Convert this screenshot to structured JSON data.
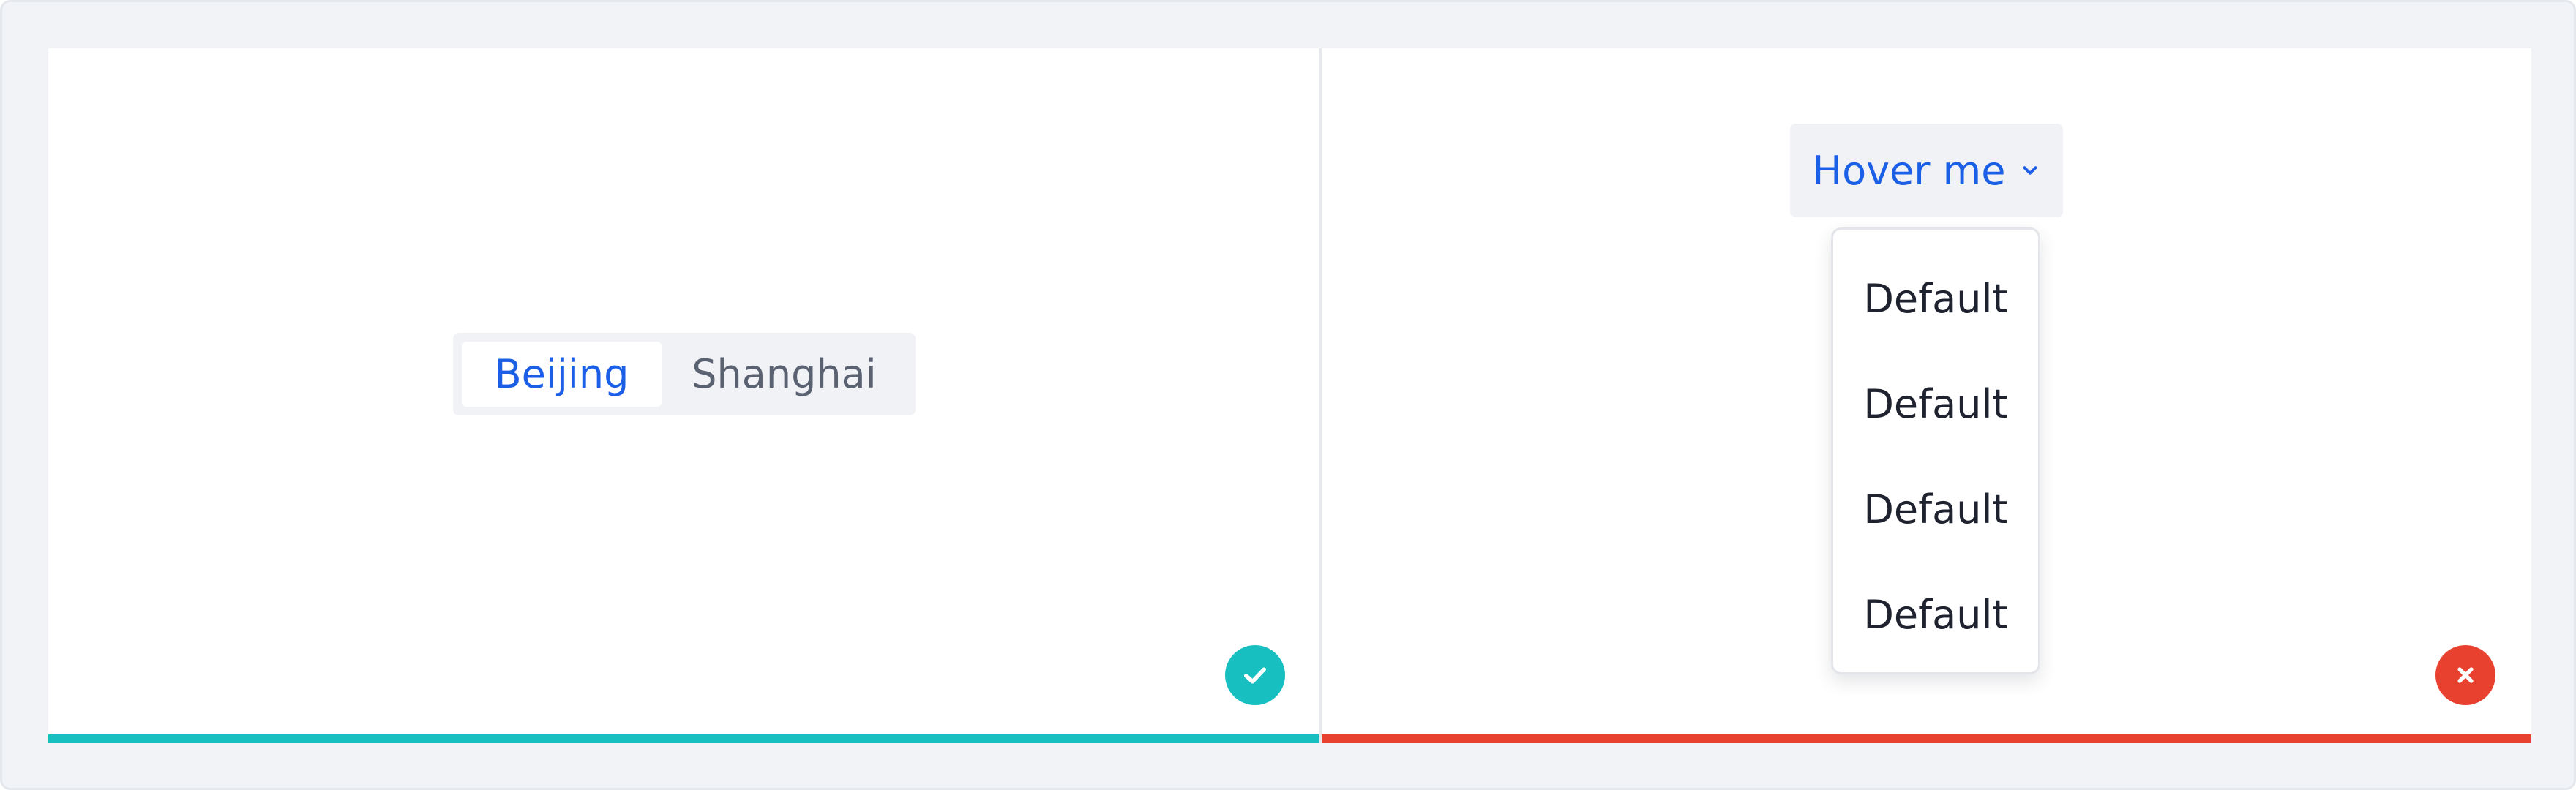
{
  "left_panel": {
    "tabs": [
      {
        "label": "Beijing",
        "active": true
      },
      {
        "label": "Shanghai",
        "active": false
      }
    ],
    "status": "correct",
    "status_icon": "check-icon",
    "accent_color": "#17bfc0"
  },
  "right_panel": {
    "dropdown": {
      "trigger_label": "Hover me",
      "items": [
        "Default",
        "Default",
        "Default",
        "Default"
      ]
    },
    "status": "incorrect",
    "status_icon": "close-icon",
    "accent_color": "#e8412f"
  },
  "colors": {
    "primary_text": "#1a5fe6",
    "muted_text": "#5a6272",
    "background": "#f1f3f7"
  }
}
